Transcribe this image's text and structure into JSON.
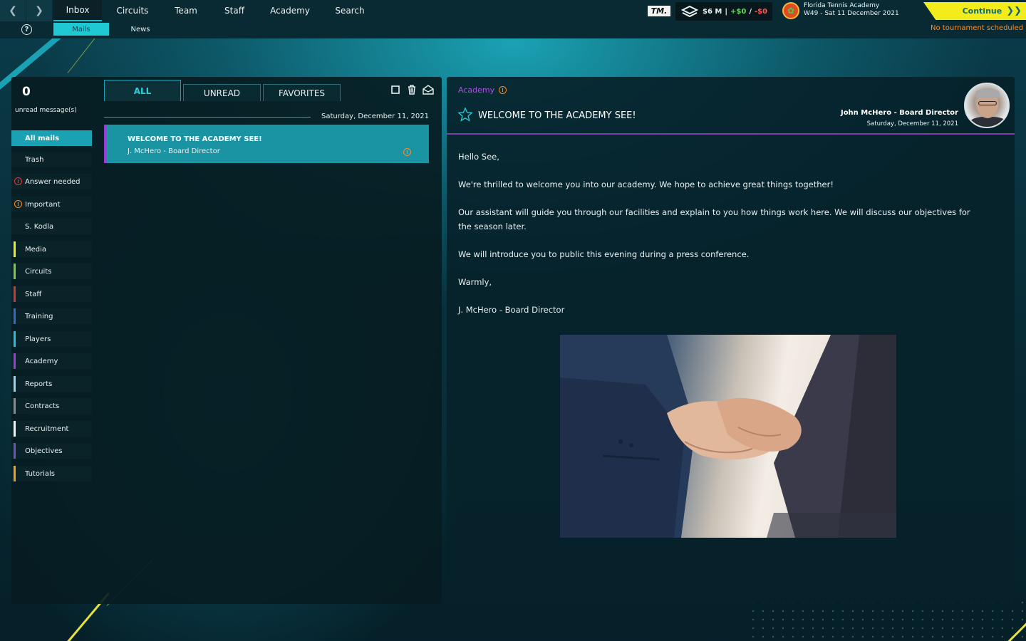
{
  "nav": {
    "back_icon": "chevron-left-icon",
    "forward_icon": "chevron-right-icon",
    "help_icon": "help-circle-icon",
    "help_glyph": "?",
    "main_tabs": [
      {
        "label": "Inbox",
        "active": true
      },
      {
        "label": "Circuits",
        "active": false
      },
      {
        "label": "Team",
        "active": false
      },
      {
        "label": "Staff",
        "active": false
      },
      {
        "label": "Academy",
        "active": false
      },
      {
        "label": "Search",
        "active": false
      }
    ],
    "sub_tabs": [
      {
        "label": "Mails",
        "active": true
      },
      {
        "label": "News",
        "active": false
      }
    ]
  },
  "status": {
    "logo_text": "TM.",
    "budget": "$6 M",
    "income": "+$0",
    "expense": "-$0",
    "academy_name": "Florida Tennis Academy",
    "date_line": "W49 - Sat 11 December 2021",
    "continue_label": "Continue",
    "continue_icon": "double-chevron-right-icon",
    "tournament_notice": "No tournament scheduled"
  },
  "sidebar": {
    "unread_count": "0",
    "unread_label": "unread message(s)",
    "folders": [
      {
        "label": "All mails",
        "active": true,
        "color": null
      },
      {
        "label": "Trash",
        "color": null
      },
      {
        "label": "Answer needed",
        "icon": "alert-circle-icon",
        "icon_color": "#e33b3b"
      },
      {
        "label": "Important",
        "icon": "alert-circle-icon",
        "icon_color": "#ff8c27"
      },
      {
        "label": "S. Kodla",
        "color": null
      },
      {
        "label": "Media",
        "color": "#f2ec1b"
      },
      {
        "label": "Circuits",
        "color": "#7ccf3a"
      },
      {
        "label": "Staff",
        "color": "#c8393a"
      },
      {
        "label": "Training",
        "color": "#2f6bc5"
      },
      {
        "label": "Players",
        "color": "#28bfd9"
      },
      {
        "label": "Academy",
        "color": "#9b3dd6"
      },
      {
        "label": "Reports",
        "color": "#9ad3ea"
      },
      {
        "label": "Contracts",
        "color": "#8b8b8b"
      },
      {
        "label": "Recruitment",
        "color": "#f4f4f4"
      },
      {
        "label": "Objectives",
        "color": "#6a55b8"
      },
      {
        "label": "Tutorials",
        "color": "#f2a11b"
      }
    ]
  },
  "mail_list": {
    "tabs": [
      {
        "label": "ALL",
        "active": true
      },
      {
        "label": "UNREAD",
        "active": false
      },
      {
        "label": "FAVORITES",
        "active": false
      }
    ],
    "actions": [
      "select-all-icon",
      "trash-icon",
      "mark-read-icon"
    ],
    "date_header": "Saturday, December 11, 2021",
    "items": [
      {
        "subject": "WELCOME TO THE ACADEMY SEE!",
        "from": "J. McHero - Board Director",
        "alert_icon": "alert-circle-icon",
        "alert_glyph": "!"
      }
    ]
  },
  "reader": {
    "category": "Academy",
    "category_color": "#b04fe8",
    "category_alert_glyph": "!",
    "title": "WELCOME TO THE ACADEMY SEE!",
    "favorite_icon": "star-outline-icon",
    "sender": "John McHero - Board Director",
    "date": "Saturday, December 11, 2021",
    "avatar_icon": "sender-avatar",
    "paragraphs": [
      "Hello See,",
      "We're thrilled to welcome you into our academy. We hope to achieve great things together!",
      "Our assistant will guide you through our facilities and explain to you how things work here. We will discuss our objectives for the season later.",
      "We will introduce you to public this evening during a press conference.",
      "Warmly,",
      "J. McHero - Board Director"
    ],
    "image": "handshake-photo"
  }
}
